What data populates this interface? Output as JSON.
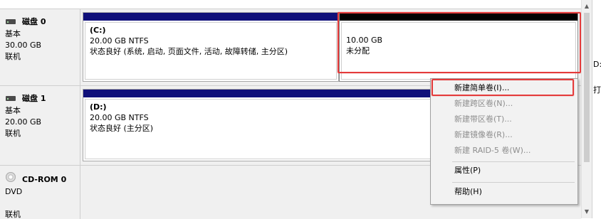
{
  "disks": [
    {
      "name": "磁盘 0",
      "type": "基本",
      "size": "30.00 GB",
      "status": "联机"
    },
    {
      "name": "磁盘 1",
      "type": "基本",
      "size": "20.00 GB",
      "status": "联机"
    },
    {
      "name": "CD-ROM 0",
      "type": "DVD",
      "status": "联机"
    }
  ],
  "partitions": {
    "c": {
      "label": "(C:)",
      "size": "20.00 GB NTFS",
      "status": "状态良好 (系统, 启动, 页面文件, 活动, 故障转储, 主分区)"
    },
    "unalloc": {
      "size": "10.00 GB",
      "status": "未分配"
    },
    "d": {
      "label": "(D:)",
      "size": "20.00 GB NTFS",
      "status": "状态良好 (主分区)"
    }
  },
  "context_menu": {
    "items": [
      {
        "label": "新建简单卷(I)...",
        "enabled": true
      },
      {
        "label": "新建跨区卷(N)...",
        "enabled": false
      },
      {
        "label": "新建带区卷(T)...",
        "enabled": false
      },
      {
        "label": "新建镜像卷(R)...",
        "enabled": false
      },
      {
        "label": "新建 RAID-5 卷(W)...",
        "enabled": false
      },
      {
        "label": "属性(P)",
        "enabled": true
      },
      {
        "label": "帮助(H)",
        "enabled": true
      }
    ]
  },
  "right_panel": {
    "text_1": "D:",
    "text_2": "打开"
  },
  "colors": {
    "partition_bar": "#10107a",
    "highlight": "#e43b3b"
  },
  "icons": {
    "disk": "disk-icon",
    "cdrom": "cdrom-icon",
    "scroll_up": "scroll-up-arrow",
    "scroll_down": "scroll-down-arrow"
  }
}
